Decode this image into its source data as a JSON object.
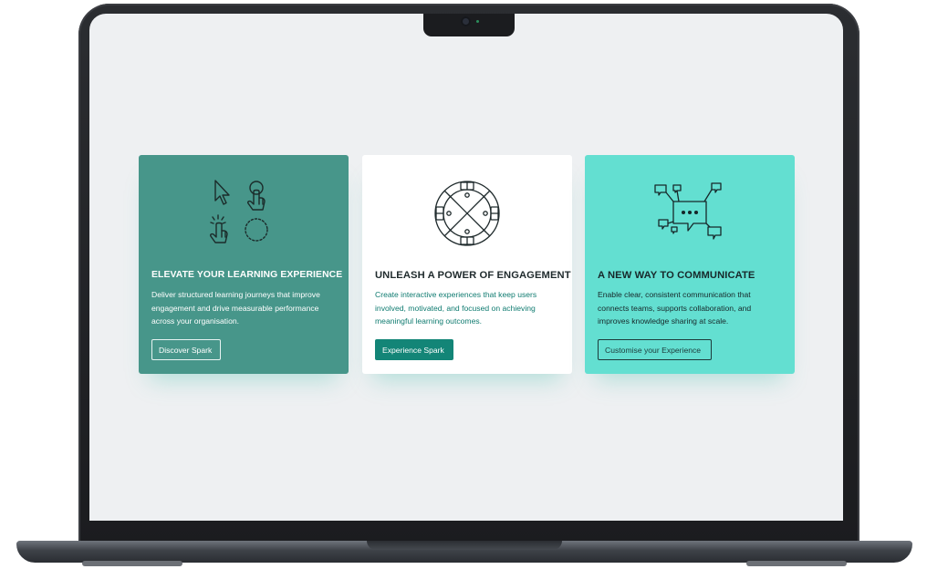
{
  "cards": [
    {
      "title": "ELEVATE YOUR LEARNING EXPERIENCE",
      "text": "Deliver structured learning journeys that improve engagement and drive measurable performance across your organisation.",
      "button_label": "Discover Spark",
      "icon": "interaction-cursor-icon",
      "background": "#47968a"
    },
    {
      "title": "UNLEASH A POWER OF ENGAGEMENT",
      "text": "Create interactive experiences that keep users involved, motivated, and focused on achieving meaningful learning outcomes.",
      "button_label": "Experience Spark",
      "icon": "engagement-wheel-icon",
      "background": "#ffffff"
    },
    {
      "title": "A NEW WAY TO COMMUNICATE",
      "text": "Enable clear, consistent communication that connects teams, supports collaboration, and improves knowledge sharing at scale.",
      "button_label": "Customise your Experience",
      "icon": "chat-bubbles-icon",
      "background": "#63dfd1"
    }
  ],
  "colors": {
    "screen_background": "#eef0f2",
    "accent": "#138577",
    "laptop_frame": "#1b1c1f"
  }
}
